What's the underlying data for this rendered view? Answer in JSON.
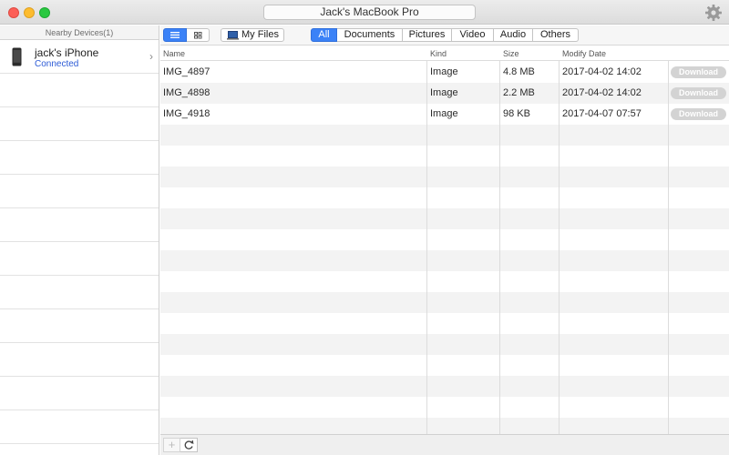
{
  "window": {
    "title": "Jack's MacBook Pro"
  },
  "sidebar": {
    "header": "Nearby Devices(1)",
    "devices": [
      {
        "name": "jack's iPhone",
        "status": "Connected"
      }
    ]
  },
  "toolbar": {
    "my_files_label": "My Files",
    "filters": [
      "All",
      "Documents",
      "Pictures",
      "Video",
      "Audio",
      "Others"
    ],
    "active_filter": "All",
    "view_mode": "list"
  },
  "table": {
    "columns": [
      "Name",
      "Kind",
      "Size",
      "Modify Date"
    ],
    "rows": [
      {
        "name": "IMG_4897",
        "kind": "Image",
        "size": "4.8 MB",
        "date": "2017-04-02 14:02",
        "action": "Download"
      },
      {
        "name": "IMG_4898",
        "kind": "Image",
        "size": "2.2 MB",
        "date": "2017-04-02 14:02",
        "action": "Download"
      },
      {
        "name": "IMG_4918",
        "kind": "Image",
        "size": "98 KB",
        "date": "2017-04-07 07:57",
        "action": "Download"
      }
    ]
  },
  "bottombar": {
    "add_icon": "plus-icon",
    "refresh_icon": "refresh-icon"
  },
  "colors": {
    "accent": "#3b82f7",
    "status_connected": "#2d5bd6",
    "download_disabled": "#d3d3d3",
    "row_alt": "#f3f3f3"
  }
}
